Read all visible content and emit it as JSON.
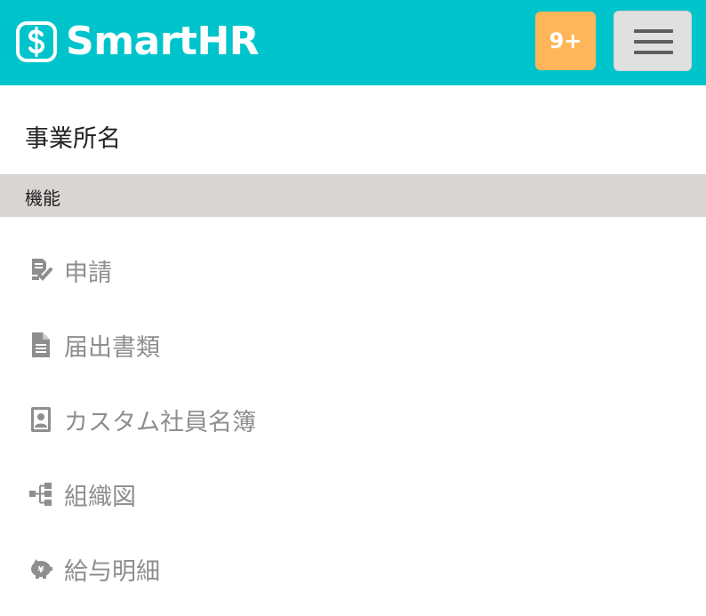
{
  "header": {
    "logo_text": "SmartHR",
    "brand_color": "#00c4cc",
    "notifications_badge": "9+",
    "badge_color": "#ffb65a",
    "menu_icon": "hamburger-icon"
  },
  "office": {
    "name": "事業所名"
  },
  "features_section": {
    "title": "機能",
    "items": [
      {
        "label": "申請",
        "icon": "request-check-icon"
      },
      {
        "label": "届出書類",
        "icon": "document-icon"
      },
      {
        "label": "カスタム社員名簿",
        "icon": "employee-directory-icon"
      },
      {
        "label": "組織図",
        "icon": "org-chart-icon"
      },
      {
        "label": "給与明細",
        "icon": "piggy-bank-yen-icon"
      }
    ]
  }
}
